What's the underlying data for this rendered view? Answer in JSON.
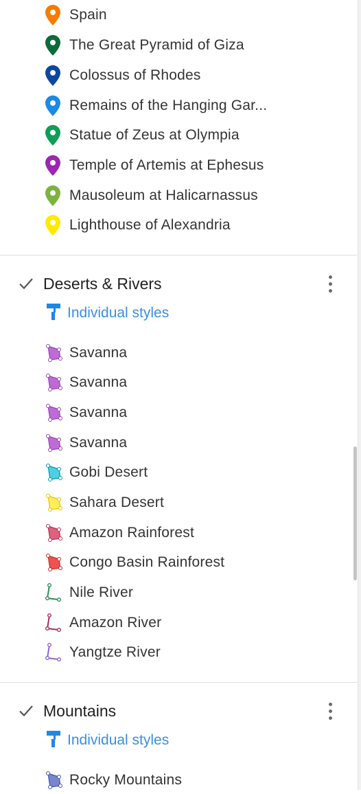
{
  "places": {
    "items": [
      {
        "label": "Spain",
        "color": "#f57c00"
      },
      {
        "label": "The Great Pyramid of Giza",
        "color": "#0b6b3a"
      },
      {
        "label": "Colossus of Rhodes",
        "color": "#0d47a1"
      },
      {
        "label": "Remains of the Hanging Gar...",
        "color": "#1e88e5"
      },
      {
        "label": "Statue of Zeus at Olympia",
        "color": "#0f9d58"
      },
      {
        "label": "Temple of Artemis at Ephesus",
        "color": "#9c27b0"
      },
      {
        "label": "Mausoleum at Halicarnassus",
        "color": "#7cb342"
      },
      {
        "label": "Lighthouse of Alexandria",
        "color": "#ffea00"
      }
    ]
  },
  "layers": {
    "deserts": {
      "title": "Deserts & Rivers",
      "checked": true,
      "style_label": "Individual styles",
      "items": [
        {
          "label": "Savanna",
          "type": "polygon",
          "color": "#c06ad8"
        },
        {
          "label": "Savanna",
          "type": "polygon",
          "color": "#c06ad8"
        },
        {
          "label": "Savanna",
          "type": "polygon",
          "color": "#c06ad8"
        },
        {
          "label": "Savanna",
          "type": "polygon",
          "color": "#c06ad8"
        },
        {
          "label": "Gobi Desert",
          "type": "polygon",
          "color": "#4dd0e1"
        },
        {
          "label": "Sahara Desert",
          "type": "polygon",
          "color": "#ffee58"
        },
        {
          "label": "Amazon Rainforest",
          "type": "polygon",
          "color": "#e0607e"
        },
        {
          "label": "Congo Basin Rainforest",
          "type": "polygon",
          "color": "#ef5350"
        },
        {
          "label": "Nile River",
          "type": "line",
          "color": "#2e8b57"
        },
        {
          "label": "Amazon River",
          "type": "line",
          "color": "#a03060"
        },
        {
          "label": "Yangtze River",
          "type": "line",
          "color": "#8e63ce"
        }
      ]
    },
    "mountains": {
      "title": "Mountains",
      "checked": true,
      "style_label": "Individual styles",
      "items": [
        {
          "label": "Rocky Mountains",
          "type": "polygon",
          "color": "#7986cb"
        }
      ]
    }
  },
  "colors": {
    "link": "#3b8ee0",
    "paint_icon": "#1e88e5",
    "divider": "#e0e0e0"
  }
}
